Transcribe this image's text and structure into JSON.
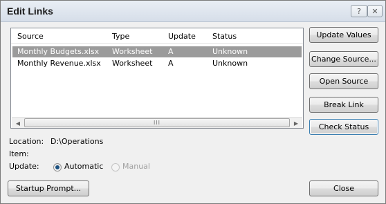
{
  "dialog": {
    "title": "Edit Links",
    "help_glyph": "?",
    "close_glyph": "✕"
  },
  "list": {
    "columns": [
      "Source",
      "Type",
      "Update",
      "Status"
    ],
    "rows": [
      {
        "source": "Monthly Budgets.xlsx",
        "type": "Worksheet",
        "update": "A",
        "status": "Unknown",
        "selected": true
      },
      {
        "source": "Monthly Revenue.xlsx",
        "type": "Worksheet",
        "update": "A",
        "status": "Unknown",
        "selected": false
      }
    ],
    "scroll_left_glyph": "◀",
    "scroll_right_glyph": "▶",
    "scroll_thumb_grip": "III"
  },
  "buttons": {
    "update_values": "Update Values",
    "change_source": "Change Source...",
    "open_source": "Open Source",
    "break_link": "Break Link",
    "check_status": "Check Status",
    "startup_prompt": "Startup Prompt...",
    "close": "Close"
  },
  "info": {
    "location_label": "Location:",
    "location_value": "D:\\Operations",
    "item_label": "Item:",
    "update_label": "Update:",
    "automatic_label": "Automatic",
    "manual_label": "Manual",
    "update_selected": "Automatic"
  }
}
